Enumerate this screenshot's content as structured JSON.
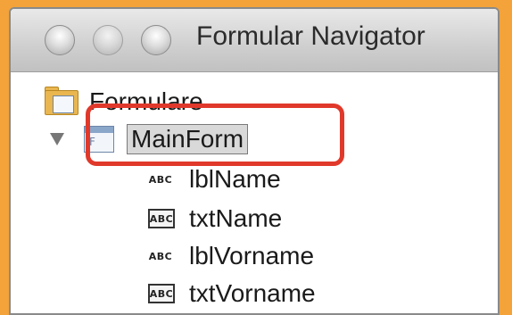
{
  "window": {
    "title": "Formular Navigator"
  },
  "tree": {
    "root": {
      "label": "Formulare",
      "icon": "forms-folder-icon"
    },
    "form": {
      "label": "MainForm",
      "icon": "form-icon",
      "icon_glyph": "F",
      "expanded": true
    },
    "controls": [
      {
        "label": "lblName",
        "icon_text": "ABC",
        "kind": "label"
      },
      {
        "label": "txtName",
        "icon_text": "ABC",
        "kind": "textbox"
      },
      {
        "label": "lblVorname",
        "icon_text": "ABC",
        "kind": "label"
      },
      {
        "label": "txtVorname",
        "icon_text": "ABC",
        "kind": "textbox"
      }
    ]
  },
  "colors": {
    "highlight": "#e0392b",
    "background": "#f3a33a"
  }
}
